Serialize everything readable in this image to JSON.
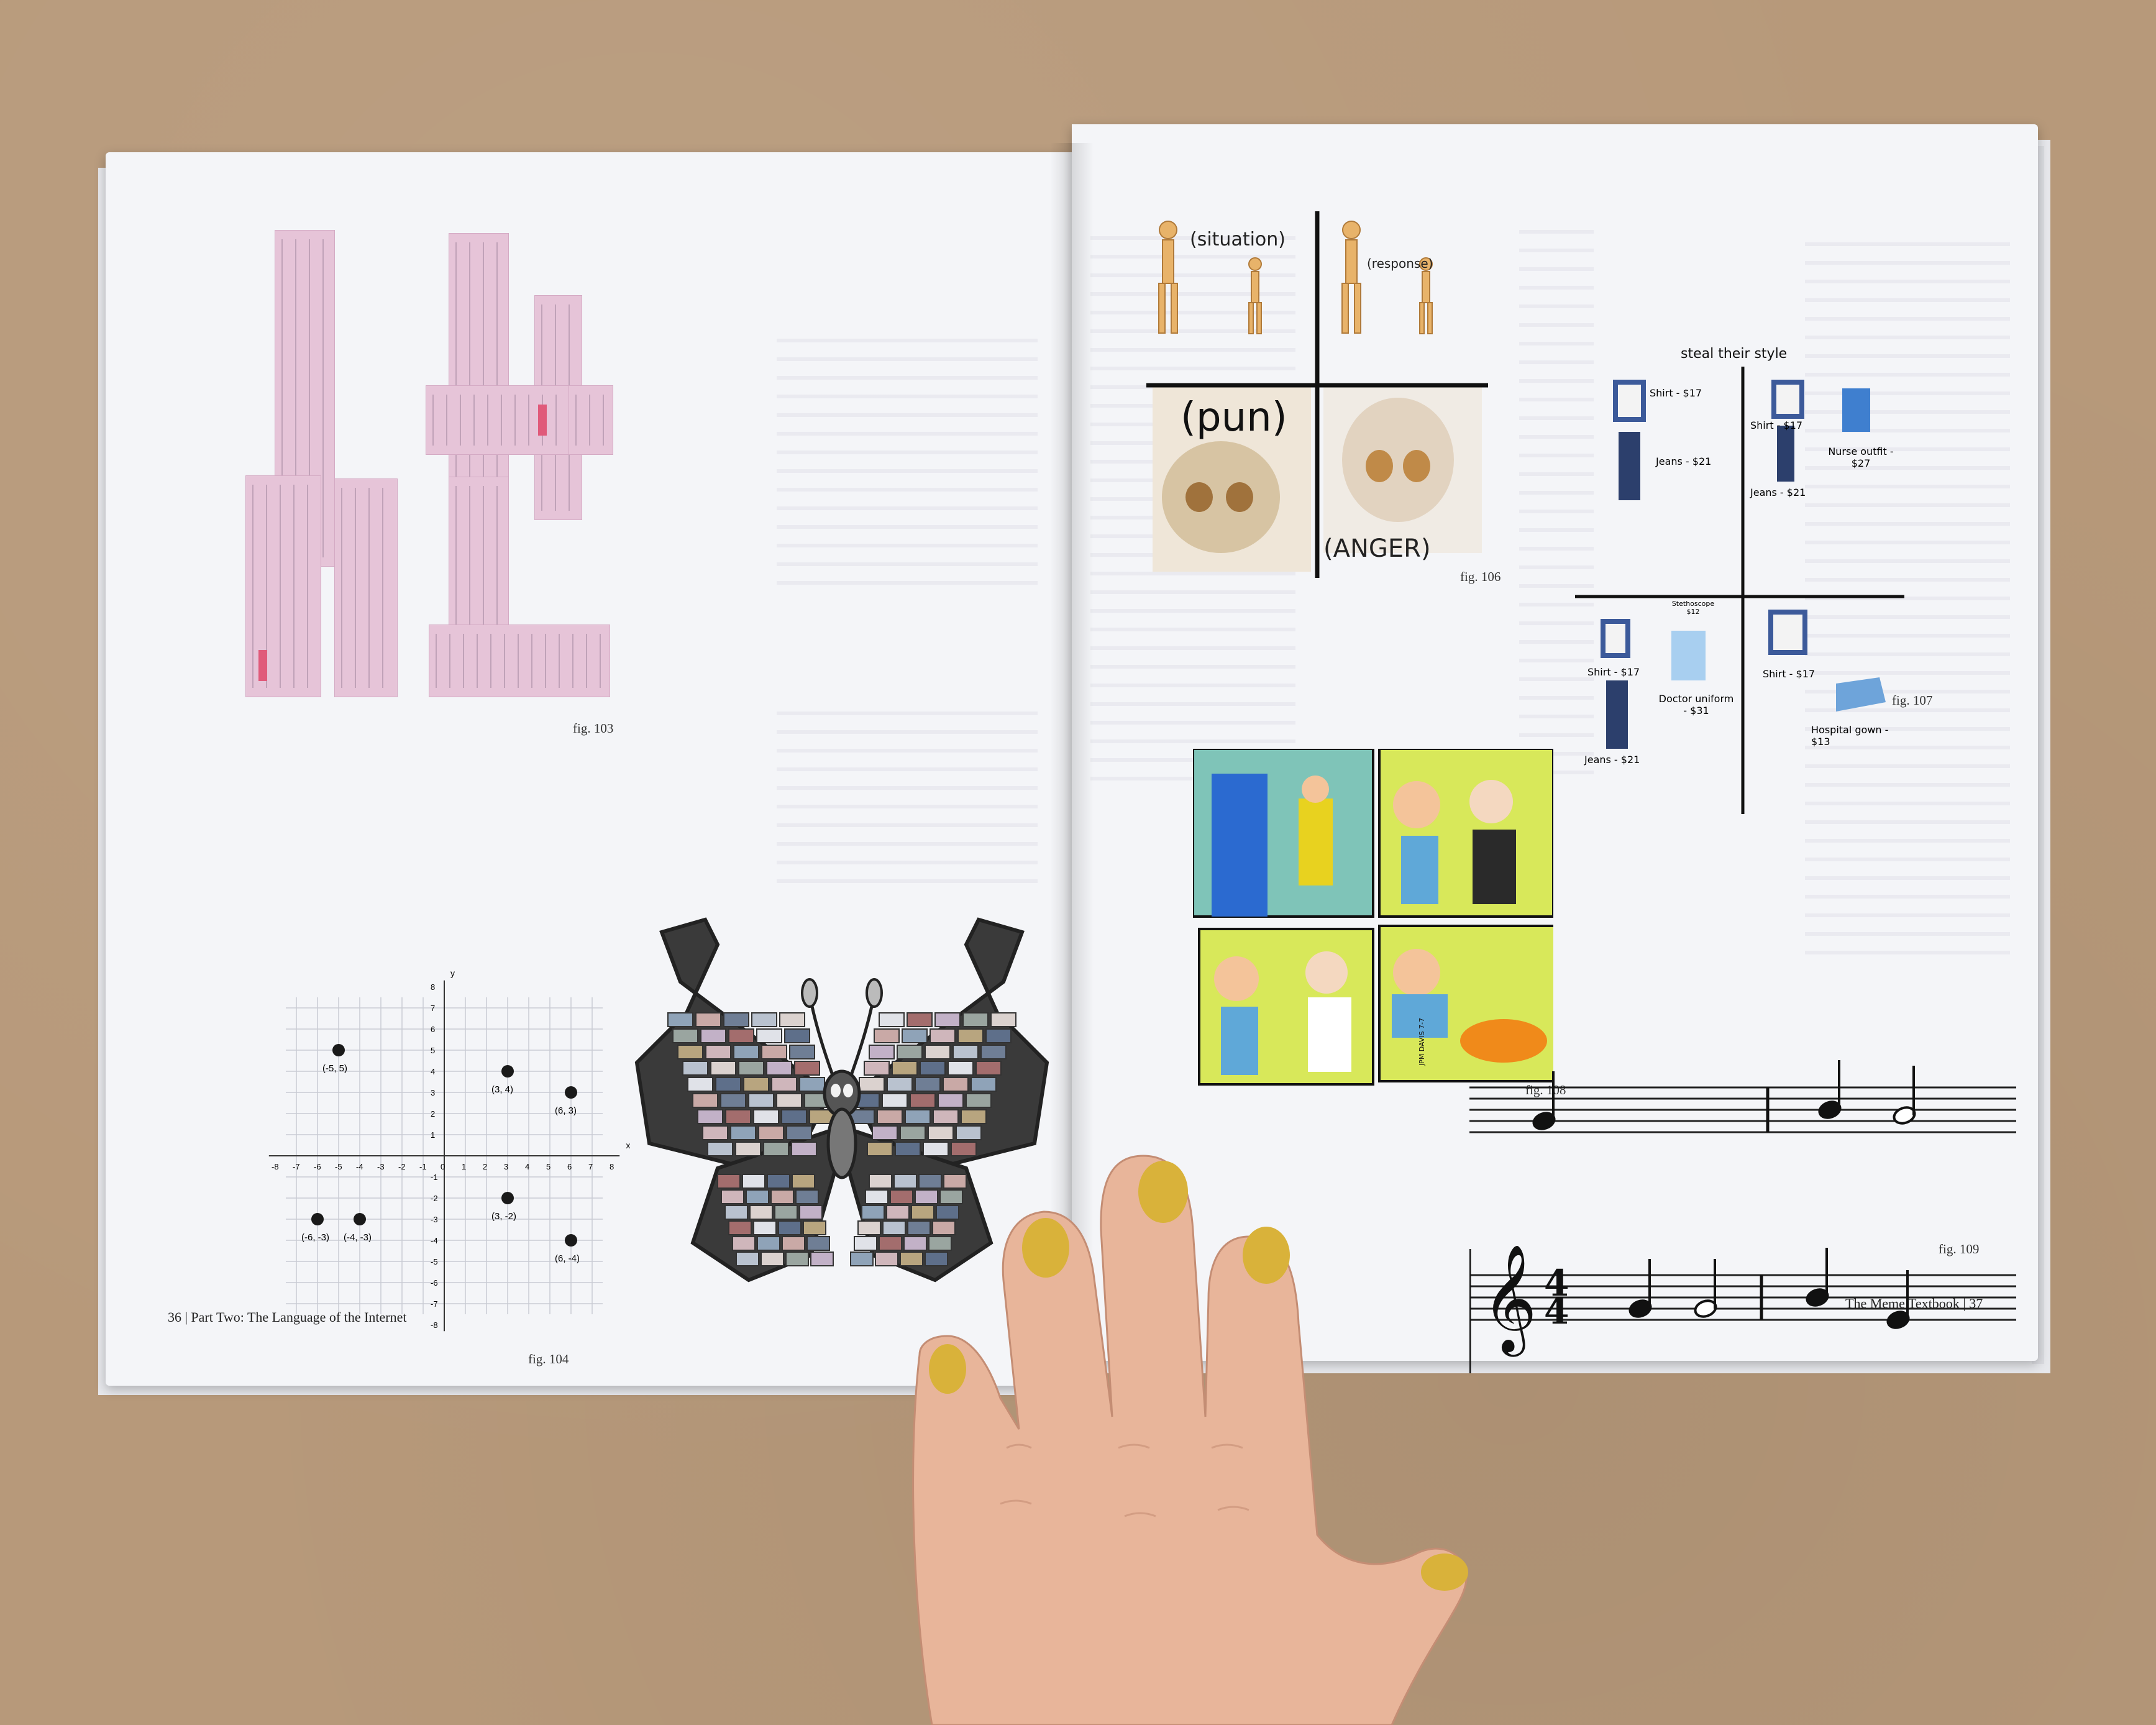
{
  "left_page": {
    "captions": [
      "fig. 103",
      "fig. 104"
    ],
    "footer": "36 | Part Two: The Language of the Internet",
    "plot": {
      "axis_x_label": "x",
      "axis_y_label": "y",
      "x_ticks": [
        "-8",
        "-7",
        "-6",
        "-5",
        "-4",
        "-3",
        "-2",
        "-1",
        "0",
        "1",
        "2",
        "3",
        "4",
        "5",
        "6",
        "7",
        "8"
      ],
      "y_ticks": [
        "8",
        "7",
        "6",
        "5",
        "4",
        "3",
        "2",
        "1",
        "-1",
        "-2",
        "-3",
        "-4",
        "-5",
        "-6",
        "-7",
        "-8"
      ],
      "points": [
        {
          "x": -5,
          "y": 5,
          "label": "(-5, 5)"
        },
        {
          "x": 3,
          "y": 4,
          "label": "(3, 4)"
        },
        {
          "x": 6,
          "y": 3,
          "label": "(6, 3)"
        },
        {
          "x": -6,
          "y": -3,
          "label": "(-6, -3)"
        },
        {
          "x": -4,
          "y": -3,
          "label": "(-4, -3)"
        },
        {
          "x": 3,
          "y": -2,
          "label": "(3, -2)"
        },
        {
          "x": 6,
          "y": -4,
          "label": "(6, -4)"
        }
      ]
    }
  },
  "right_page": {
    "captions": [
      "fig. 106",
      "fig. 107",
      "fig. 108",
      "fig. 109"
    ],
    "footer": "The Meme Textbook | 37",
    "skeleton_meme": {
      "situation": "(situation)",
      "response": "(response)",
      "pun": "(pun)",
      "anger": "(ANGER)"
    },
    "style_meme": {
      "title": "steal their style",
      "items": [
        "Shirt - $17",
        "Jeans - $21",
        "Shirt - $17",
        "Jeans - $21",
        "Nurse outfit - $27",
        "Stethoscope $12",
        "Shirt - $17",
        "Jeans - $21",
        "Doctor uniform - $31",
        "Shirt - $17",
        "Hospital gown - $13"
      ]
    },
    "comic_signature": "JPM DAVIS 7-7"
  },
  "colors": {
    "table": "#b7997a",
    "paper": "#f4f5f8",
    "card": "#e6c4d8",
    "nail": "#d9b23a",
    "skin": "#e8b59a"
  }
}
